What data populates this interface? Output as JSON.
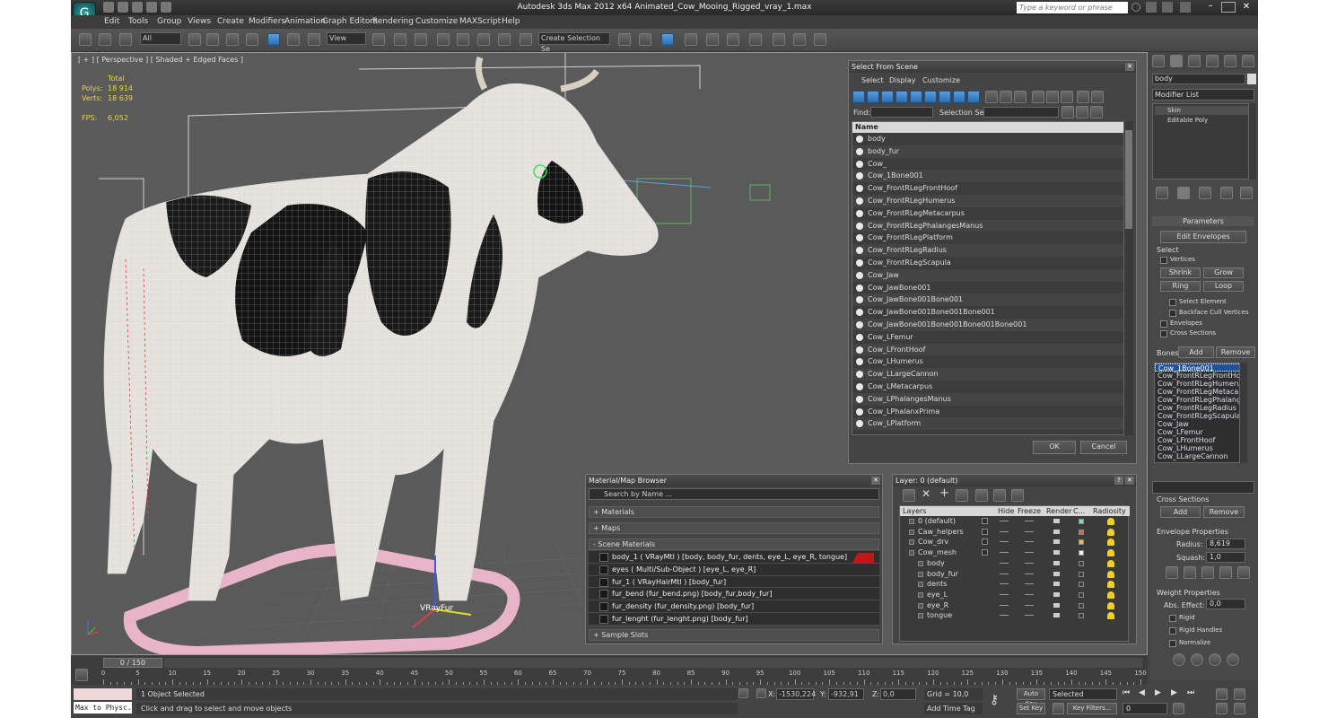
{
  "window": {
    "title": "Autodesk 3ds Max  2012 x64     Animated_Cow_Mooing_Rigged_vray_1.max",
    "search_placeholder": "Type a keyword or phrase"
  },
  "menu": [
    "Edit",
    "Tools",
    "Group",
    "Views",
    "Create",
    "Modifiers",
    "Animation",
    "Graph Editors",
    "Rendering",
    "Customize",
    "MAXScript",
    "Help"
  ],
  "toolbar": {
    "selection_filter": "All",
    "ref_coord": "View",
    "named_selection": "Create Selection Se"
  },
  "viewport": {
    "label": "[ + ] [ Perspective ] [ Shaded + Edged Faces ]",
    "stats": {
      "total_label": "Total",
      "polys_label": "Polys:",
      "polys": "18 914",
      "verts_label": "Verts:",
      "verts": "18 639",
      "fps_label": "FPS:",
      "fps": "6,052"
    },
    "object_label": "VRayFur"
  },
  "select_from_scene": {
    "title": "Select From Scene",
    "menu": [
      "Select",
      "Display",
      "Customize"
    ],
    "find_label": "Find:",
    "selection_set_label": "Selection Set:",
    "column_name": "Name",
    "items": [
      "body",
      "body_fur",
      "Cow_",
      "Cow_1Bone001",
      "Cow_FrontRLegFrontHoof",
      "Cow_FrontRLegHumerus",
      "Cow_FrontRLegMetacarpus",
      "Cow_FrontRLegPhalangesManus",
      "Cow_FrontRLegPlatform",
      "Cow_FrontRLegRadius",
      "Cow_FrontRLegScapula",
      "Cow_Jaw",
      "Cow_JawBone001",
      "Cow_JawBone001Bone001",
      "Cow_JawBone001Bone001Bone001",
      "Cow_JawBone001Bone001Bone001Bone001",
      "Cow_LFemur",
      "Cow_LFrontHoof",
      "Cow_LHumerus",
      "Cow_LLargeCannon",
      "Cow_LMetacarpus",
      "Cow_LPhalangesManus",
      "Cow_LPhalanxPrima",
      "Cow_LPlatform"
    ],
    "ok": "OK",
    "cancel": "Cancel"
  },
  "material_browser": {
    "title": "Material/Map Browser",
    "search_placeholder": "Search by Name ...",
    "sections": [
      "+ Materials",
      "+ Maps",
      "- Scene Materials"
    ],
    "scene_materials": [
      "body_1  ( VRayMtl ) [body, body_fur, dents, eye_L, eye_R, tongue]",
      "eyes  ( Multi/Sub-Object ) [eye_L, eye_R]",
      "fur_1  ( VRayHairMtl ) [body_fur]",
      "fur_bend (fur_bend.png) [body_fur,body_fur]",
      "fur_density (fur_density.png) [body_fur]",
      "fur_lenght (fur_lenght.png) [body_fur]"
    ],
    "sample_slots": "+ Sample Slots"
  },
  "layer_manager": {
    "title": "Layer: 0 (default)",
    "columns": [
      "Layers",
      "Hide",
      "Freeze",
      "Render",
      "C...",
      "Radiosity"
    ],
    "rows": [
      {
        "name": "0 (default)",
        "indent": 0,
        "color": "#8ad0e0"
      },
      {
        "name": "Caw_helpers",
        "indent": 0,
        "color": "#e06060"
      },
      {
        "name": "Cow_drv",
        "indent": 0,
        "color": "#e0c060"
      },
      {
        "name": "Cow_mesh",
        "indent": 0,
        "color": "#f0f0f0"
      },
      {
        "name": "body",
        "indent": 1,
        "color": ""
      },
      {
        "name": "body_fur",
        "indent": 1,
        "color": ""
      },
      {
        "name": "dents",
        "indent": 1,
        "color": ""
      },
      {
        "name": "eye_L",
        "indent": 1,
        "color": ""
      },
      {
        "name": "eye_R",
        "indent": 1,
        "color": ""
      },
      {
        "name": "tongue",
        "indent": 1,
        "color": ""
      }
    ]
  },
  "command_panel": {
    "object_name": "body",
    "modifier_list": "Modifier List",
    "stack": [
      "Skin",
      "Editable Poly"
    ],
    "parameters": "Parameters",
    "edit_envelopes": "Edit Envelopes",
    "select_label": "Select",
    "vertices": "Vertices",
    "shrink": "Shrink",
    "grow": "Grow",
    "ring": "Ring",
    "loop": "Loop",
    "select_element": "Select Element",
    "backface_cull": "Backface Cull Vertices",
    "envelopes": "Envelopes",
    "cross_sections": "Cross Sections",
    "bones_label": "Bones:",
    "add": "Add",
    "remove": "Remove",
    "bones": [
      "Cow_1Bone001",
      "Cow_FrontRLegFrontHoof",
      "Cow_FrontRLegHumerus",
      "Cow_FrontRLegMetacarpus",
      "Cow_FrontRLegPhalangesM",
      "Cow_FrontRLegRadius",
      "Cow_FrontRLegScapula",
      "Cow_Jaw",
      "Cow_LFemur",
      "Cow_LFrontHoof",
      "Cow_LHumerus",
      "Cow_LLargeCannon"
    ],
    "cross_sections_group": "Cross Sections",
    "cs_add": "Add",
    "cs_remove": "Remove",
    "envelope_props": "Envelope Properties",
    "radius_label": "Radius:",
    "radius": "8,619",
    "squash_label": "Squash:",
    "squash": "1,0",
    "weight_props": "Weight Properties",
    "abs_effect_label": "Abs. Effect:",
    "abs_effect": "0,0",
    "rigid": "Rigid",
    "rigid_handles": "Rigid Handles",
    "normalize": "Normalize"
  },
  "timeline": {
    "frame": "0 / 150",
    "ticks": [
      0,
      5,
      10,
      15,
      20,
      25,
      30,
      35,
      40,
      45,
      50,
      55,
      60,
      65,
      70,
      75,
      80,
      85,
      90,
      95,
      100,
      105,
      110,
      115,
      120,
      125,
      130,
      135,
      140,
      145,
      150
    ]
  },
  "status": {
    "script_listener": "Max to Physc.",
    "selected": "1 Object Selected",
    "prompt": "Click and drag to select and move objects",
    "x_label": "X:",
    "x": "-1530,224",
    "y_label": "Y:",
    "y": "-932,91",
    "z_label": "Z:",
    "z": "0,0",
    "grid": "Grid = 10,0",
    "add_time_tag": "Add Time Tag",
    "auto_key": "Auto Key",
    "set_key": "Set Key",
    "key_selected": "Selected",
    "key_filters": "Key Filters...",
    "frame_field": "0"
  }
}
